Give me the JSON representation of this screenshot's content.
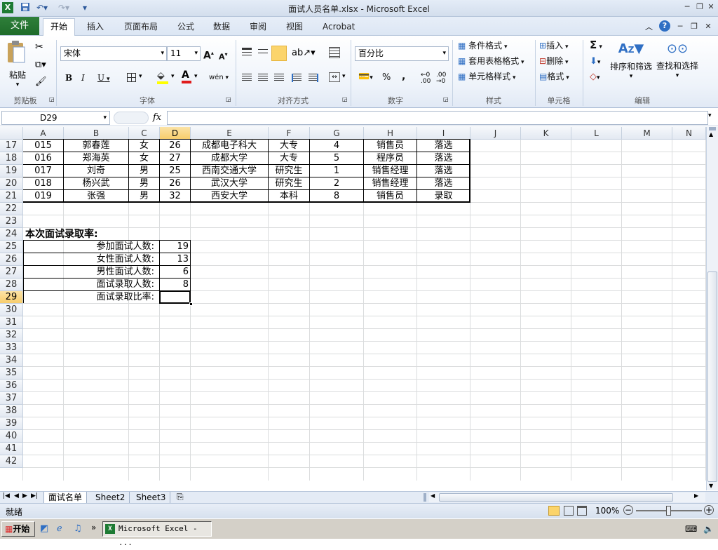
{
  "window": {
    "title": "面试人员名单.xlsx - Microsoft Excel",
    "app_icon": "X"
  },
  "tabs": {
    "file": "文件",
    "items": [
      "开始",
      "插入",
      "页面布局",
      "公式",
      "数据",
      "审阅",
      "视图",
      "Acrobat"
    ]
  },
  "ribbon": {
    "clipboard": {
      "label": "剪贴板",
      "paste": "粘贴"
    },
    "font": {
      "label": "字体",
      "name": "宋体",
      "size": "11",
      "bold": "B",
      "italic": "I",
      "underline": "U",
      "grow": "A",
      "shrink": "A",
      "phonetic": "wén",
      "color_a": "A"
    },
    "alignment": {
      "label": "对齐方式"
    },
    "number": {
      "label": "数字",
      "format": "百分比",
      "percent": "%",
      "comma": ","
    },
    "styles": {
      "label": "样式",
      "conditional": "条件格式",
      "table": "套用表格格式",
      "cell_styles": "单元格样式"
    },
    "cells": {
      "label": "单元格",
      "insert": "插入",
      "delete": "删除",
      "format": "格式"
    },
    "editing": {
      "label": "编辑",
      "sum": "Σ",
      "sort": "排序和筛选",
      "find": "查找和选择"
    }
  },
  "formula_bar": {
    "name_box": "D29",
    "fx": "fx",
    "value": ""
  },
  "grid": {
    "columns": [
      "A",
      "B",
      "C",
      "D",
      "E",
      "F",
      "G",
      "H",
      "I",
      "J",
      "K",
      "L",
      "M",
      "N"
    ],
    "rows": [
      "17",
      "18",
      "19",
      "20",
      "21",
      "22",
      "23",
      "24",
      "25",
      "26",
      "27",
      "28",
      "29",
      "30",
      "31",
      "32",
      "33",
      "34",
      "35",
      "36",
      "37",
      "38",
      "39",
      "40",
      "41",
      "42"
    ],
    "selected_col": "D",
    "selected_row": "29",
    "data_rows": [
      [
        "015",
        "郭春莲",
        "女",
        "26",
        "成都电子科大",
        "大专",
        "4",
        "销售员",
        "落选"
      ],
      [
        "016",
        "郑海英",
        "女",
        "27",
        "成都大学",
        "大专",
        "5",
        "程序员",
        "落选"
      ],
      [
        "017",
        "刘奇",
        "男",
        "25",
        "西南交通大学",
        "研究生",
        "1",
        "销售经理",
        "落选"
      ],
      [
        "018",
        "杨兴武",
        "男",
        "26",
        "武汉大学",
        "研究生",
        "2",
        "销售经理",
        "落选"
      ],
      [
        "019",
        "张强",
        "男",
        "32",
        "西安大学",
        "本科",
        "8",
        "销售员",
        "录取"
      ]
    ],
    "summary_title": "本次面试录取率:",
    "summary": [
      {
        "label": "参加面试人数:",
        "value": "19"
      },
      {
        "label": "女性面试人数:",
        "value": "13"
      },
      {
        "label": "男性面试人数:",
        "value": "6"
      },
      {
        "label": "面试录取人数:",
        "value": "8"
      },
      {
        "label": "面试录取比率:",
        "value": ""
      }
    ]
  },
  "sheets": [
    "面试名单",
    "Sheet2",
    "Sheet3"
  ],
  "status": {
    "ready": "就绪",
    "zoom": "100%"
  },
  "taskbar": {
    "start": "开始",
    "window": "Microsoft Excel - ..."
  }
}
